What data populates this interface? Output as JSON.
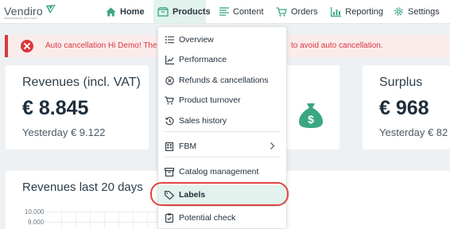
{
  "logo": {
    "name": "Vendiro",
    "tagline": "Marketplaces and more"
  },
  "nav": {
    "home": "Home",
    "products": "Products",
    "content": "Content",
    "orders": "Orders",
    "reporting": "Reporting",
    "settings": "Settings"
  },
  "alert": {
    "text_left": "Auto cancellation Hi Demo! The",
    "text_right": "to avoid auto cancellation."
  },
  "revenue_card": {
    "title": "Revenues (incl. VAT)",
    "value": "€ 8.845",
    "sub": "Yesterday € 9.122"
  },
  "surplus_card": {
    "title": "Surplus",
    "value": "€ 968",
    "sub": "Yesterday € 82"
  },
  "chart_card": {
    "title": "Revenues last 20 days",
    "y_ticks": [
      "10.000",
      "9.000"
    ]
  },
  "products_menu": {
    "items": [
      {
        "label": "Overview",
        "icon": "list-icon"
      },
      {
        "label": "Performance",
        "icon": "line-chart-icon"
      },
      {
        "label": "Refunds & cancellations",
        "icon": "cancel-circle-icon"
      },
      {
        "label": "Product turnover",
        "icon": "cart-icon"
      },
      {
        "label": "Sales history",
        "icon": "history-icon"
      },
      {
        "label": "FBM",
        "icon": "warehouse-icon"
      },
      {
        "label": "Catalog management",
        "icon": "box-icon"
      },
      {
        "label": "Labels",
        "icon": "tag-icon"
      },
      {
        "label": "Potential check",
        "icon": "clipboard-check-icon"
      }
    ]
  },
  "colors": {
    "accent_green": "#3aa683",
    "active_bg": "#e2f2ec",
    "alert_red": "#d9363e",
    "highlight_ring": "#e04642"
  }
}
